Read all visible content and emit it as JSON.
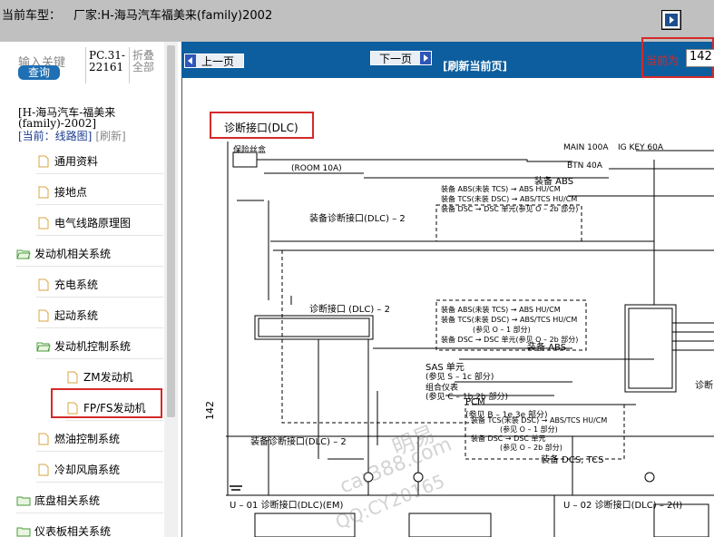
{
  "header": {
    "vehicle_label": "当前车型：",
    "vehicle_value": "厂家:H-海马汽车福美来(family)2002"
  },
  "sidebar": {
    "search_label": "输入关键",
    "search_button": "查询",
    "pc_code": "PC.31-22161",
    "fold_all": "折叠全部",
    "model": "[H-海马汽车-福美来(family)-2002]",
    "current_label": "[当前：线路图]",
    "refresh_label": "[刷新]",
    "tree": [
      {
        "label": "通用资料",
        "type": "doc"
      },
      {
        "label": "接地点",
        "type": "doc"
      },
      {
        "label": "电气线路原理图",
        "type": "doc"
      },
      {
        "label": "发动机相关系统",
        "type": "folder"
      },
      {
        "label": "充电系统",
        "type": "doc"
      },
      {
        "label": "起动系统",
        "type": "doc"
      },
      {
        "label": "发动机控制系统",
        "type": "folder"
      },
      {
        "label": "ZM发动机",
        "type": "doc"
      },
      {
        "label": "FP/FS发动机",
        "type": "doc"
      },
      {
        "label": "燃油控制系统",
        "type": "doc"
      },
      {
        "label": "冷却风扇系统",
        "type": "doc"
      },
      {
        "label": "底盘相关系统",
        "type": "folder"
      },
      {
        "label": "仪表板相关系统",
        "type": "folder"
      }
    ]
  },
  "toolbar": {
    "prev_label": "上一页",
    "next_label": "下一页",
    "refresh_label": "[刷新当前页]",
    "page_label": "当前为",
    "page_value": "142"
  },
  "diagram": {
    "title": "诊断接口(DLC)",
    "page_number": "142",
    "labels": {
      "connector": "诊断接口 (DLC) – 2",
      "diag_top": "装备诊断接口(DLC) – 2",
      "diag_bottom": "装备诊断接口(DLC) – 2",
      "abs_top": "装备 ABS",
      "abs_mid": "装备 ABS",
      "sas": "SAS 单元",
      "sas_ref": "(参见 S – 1c 部分)",
      "cluster": "组合仪表",
      "cluster_ref": "(参见 C – 1b,2b 部分)",
      "pcm": "PCM",
      "pcm_ref": "(参见 B – 1e,3e 部分)",
      "dcs_tcs": "装备 DCS, TCS",
      "u01": "U – 01 诊断接口(DLC)(EM)",
      "u02": "U – 02 诊断接口(DLC) – 2(I)",
      "main_fuse": "MAIN 100A",
      "btn_fuse": "BTN 40A",
      "ig_key": "IG KEY 60A",
      "room_fuse": "(ROOM 10A)",
      "fuse_box": "保险丝盒",
      "abs_line1": "装备 ABS(未装 TCS) → ABS HU/CM",
      "abs_line2": "装备 TCS(未装 DSC) → ABS/TCS HU/CM",
      "abs_line3": "装备 DSC → DSC 单元(参见 O – 2b 部分)",
      "abs2_line1": "装备 ABS(未装 TCS) → ABS HU/CM",
      "abs2_line2": "装备 TCS(未装 DSC) → ABS/TCS HU/CM",
      "abs2_line3": "(参见 O – 1 部分)",
      "abs2_line4": "装备 DSC → DSC 单元(参见 O – 2b 部分)",
      "tcs_line1": "装备 TCS(未装 DSC) → ABS/TCS HU/CM",
      "tcs_line2": "(参见 O – 1 部分)",
      "tcs_line3": "装备 DSC → DSC 单元",
      "tcs_line4": "(参见 O – 2b 部分)",
      "cut_right": "诊断"
    },
    "watermarks": [
      "明易",
      "car388.com",
      "QQ:CY20165"
    ]
  },
  "colors": {
    "toolbar_bg": "#0d5e9e",
    "highlight": "#d42a2a",
    "topbar_bg": "#c0c0c0"
  }
}
